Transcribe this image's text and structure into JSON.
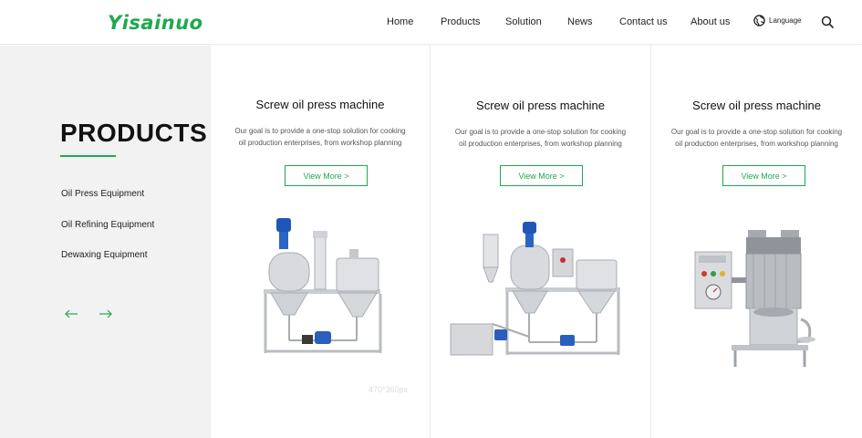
{
  "header": {
    "logo_text": "Yisainuo",
    "nav": [
      "Home",
      "Products",
      "Solution",
      "News",
      "Contact us",
      "About us"
    ],
    "language_label": "Language",
    "brand_color": "#1fa84f"
  },
  "sidebar": {
    "title": "PRODUCTS",
    "categories": [
      "Oil Press Equipment",
      "Oil Refining Equipment",
      "Dewaxing Equipment"
    ],
    "prev_icon": "arrow-left-icon",
    "next_icon": "arrow-right-icon"
  },
  "products": [
    {
      "title": "Screw oil press machine",
      "desc_line1": "Our goal is to provide a one-stop solution for cooking",
      "desc_line2": "oil production enterprises, from workshop planning",
      "button": "View More >",
      "image_note": "470*360px"
    },
    {
      "title": "Screw oil press machine",
      "desc_line1": "Our goal is to provide a one-stop solution for cooking",
      "desc_line2": "oil production enterprises, from workshop planning",
      "button": "View More >"
    },
    {
      "title": "Screw oil press machine",
      "desc_line1": "Our goal is to provide a one-stop solution for cooking",
      "desc_line2": "oil production enterprises, from workshop planning",
      "button": "View More >"
    }
  ]
}
